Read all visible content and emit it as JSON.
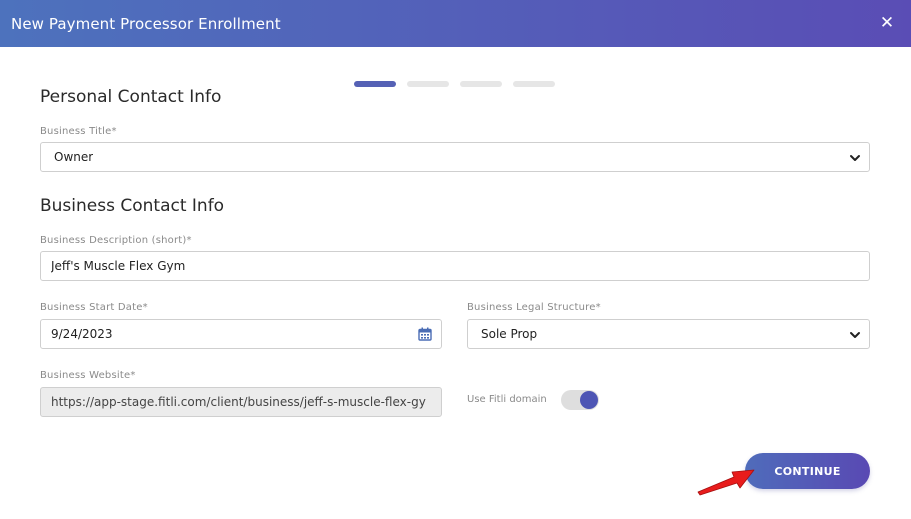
{
  "modal": {
    "title": "New Payment Processor Enrollment",
    "close_glyph": "✕",
    "accent_color": "#5561b5"
  },
  "stepper": {
    "steps": [
      {
        "state": "active"
      },
      {
        "state": "inactive"
      },
      {
        "state": "inactive"
      },
      {
        "state": "inactive"
      }
    ]
  },
  "personal": {
    "section_title": "Personal Contact Info",
    "business_title": {
      "label": "Business Title*",
      "value": "Owner"
    }
  },
  "business": {
    "section_title": "Business Contact Info",
    "description": {
      "label": "Business Description (short)*",
      "value": "Jeff's Muscle Flex Gym"
    },
    "start_date": {
      "label": "Business Start Date*",
      "value": "9/24/2023"
    },
    "legal_structure": {
      "label": "Business Legal Structure*",
      "value": "Sole Prop"
    },
    "website": {
      "label": "Business Website*",
      "value": "https://app-stage.fitli.com/client/business/jeff-s-muscle-flex-gy"
    },
    "use_domain": {
      "label": "Use Fitli domain",
      "enabled": true
    }
  },
  "actions": {
    "continue_label": "CONTINUE"
  },
  "annotation": {
    "arrow_color": "#e81c1c",
    "icon": "red-pointer-arrow-icon"
  }
}
